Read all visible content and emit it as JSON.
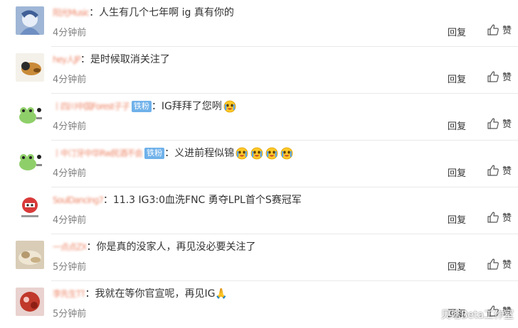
{
  "comments": [
    {
      "username": "阳光Music",
      "badge": "",
      "text": "人生有几个七年啊 ig 真有你的",
      "emoji_count": 0,
      "time": "4分钟前",
      "reply": "回复",
      "like": "赞",
      "avatar_icon": "avatar-blue-anime-icon"
    },
    {
      "username": "hey人JP",
      "badge": "",
      "text": "是时候取消关注了",
      "emoji_count": 0,
      "time": "4分钟前",
      "reply": "回复",
      "like": "赞",
      "avatar_icon": "avatar-dog-icon"
    },
    {
      "username": "丨四川中国Forest子子",
      "badge": "铁粉",
      "text": "IG拜拜了您咧",
      "emoji_count": 1,
      "time": "4分钟前",
      "reply": "回复",
      "like": "赞",
      "avatar_icon": "avatar-frog-icon"
    },
    {
      "username": "丨中汀牙中华Rw民酒不会",
      "badge": "铁粉",
      "text": "义进前程似锦",
      "emoji_count": 4,
      "time": "4分钟前",
      "reply": "回复",
      "like": "赞",
      "avatar_icon": "avatar-frog-icon"
    },
    {
      "username": "SoulDancing7",
      "badge": "",
      "text": "11.3 IG3:0血洗FNC 勇夺LPL首个S赛冠军",
      "emoji_count": 0,
      "time": "4分钟前",
      "reply": "回复",
      "like": "赞",
      "avatar_icon": "avatar-red-mask-icon"
    },
    {
      "username": "一点点ZX",
      "badge": "",
      "text": "你是真的没家人，再见没必要关注了",
      "emoji_count": 0,
      "time": "5分钟前",
      "reply": "回复",
      "like": "赞",
      "avatar_icon": "avatar-cat-icon"
    },
    {
      "username": "李先生TT",
      "badge": "",
      "text": "我就在等你官宣呢，再见IG🙏",
      "emoji_count": 0,
      "time": "5分钟前",
      "reply": "回复",
      "like": "赞",
      "avatar_icon": "avatar-red-icon"
    }
  ],
  "watermark": "贝塔Beta工作室",
  "colors": {
    "username": "#eb7350",
    "badge": "#6fb1ea",
    "time": "#808080"
  }
}
